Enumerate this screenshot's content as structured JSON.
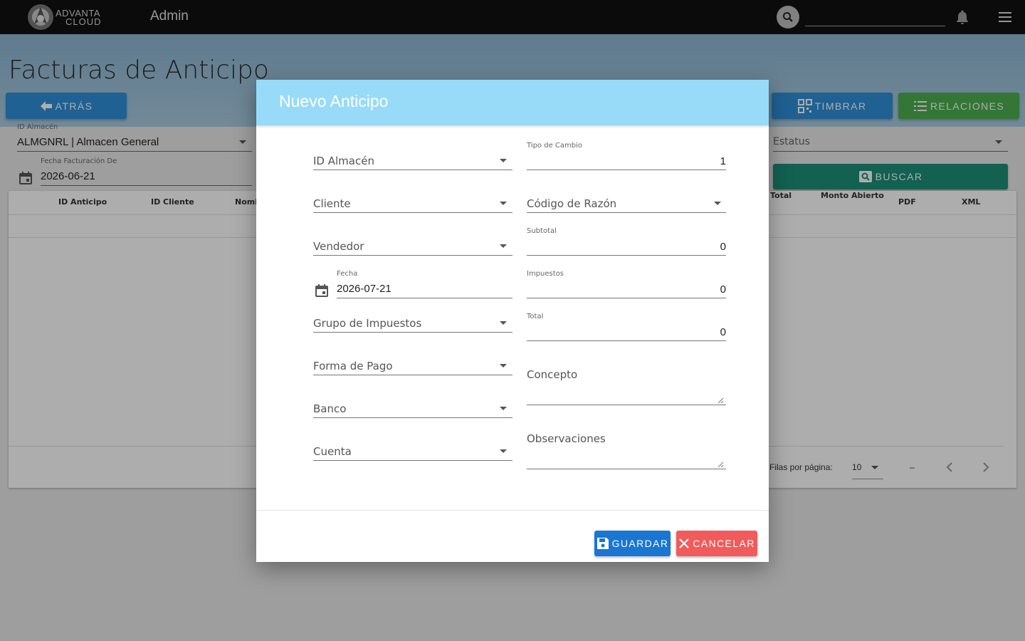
{
  "topbar": {
    "logo_line1": "ADVANTA",
    "logo_line2": "CLOUD",
    "section": "Admin",
    "search_value": ""
  },
  "page": {
    "title": "Facturas de Anticipo",
    "back_label": "ATRÁS",
    "timbrar_label": "TIMBRAR",
    "relaciones_label": "RELACIONES",
    "buscar_label": "BUSCAR"
  },
  "filters": {
    "almacen_label": "ID Almacén",
    "almacen_value": "ALMGNRL | Almacen General",
    "fecha_de_label": "Fecha Facturación De",
    "fecha_de_value": "2026-06-21",
    "estatus_placeholder": "Estatus"
  },
  "table": {
    "columns": [
      "ID Anticipo",
      "ID Cliente",
      "Nomb",
      "Total",
      "Monto Abierto",
      "PDF",
      "XML"
    ],
    "rows_per_page_label": "Filas por página:",
    "rows_per_page_value": "10",
    "range": "–"
  },
  "modal": {
    "title": "Nuevo Anticipo",
    "left_fields": {
      "almacen": "ID Almacén",
      "cliente": "Cliente",
      "vendedor": "Vendedor",
      "fecha_label": "Fecha",
      "fecha_value": "2026-07-21",
      "grupo_impuestos": "Grupo de Impuestos",
      "forma_pago": "Forma de Pago",
      "banco": "Banco",
      "cuenta": "Cuenta"
    },
    "right_fields": {
      "tipo_cambio_label": "Tipo de Cambio",
      "tipo_cambio_value": "1",
      "codigo_razon": "Código de Razón",
      "subtotal_label": "Subtotal",
      "subtotal_value": "0",
      "impuestos_label": "Impuestos",
      "impuestos_value": "0",
      "total_label": "Total",
      "total_value": "0",
      "concepto": "Concepto",
      "observaciones": "Observaciones"
    },
    "save_label": "GUARDAR",
    "cancel_label": "CANCELAR"
  },
  "colors": {
    "topbar": "#111111",
    "modal_header": "#97dbf8",
    "primary": "#1976d2",
    "success": "#4caf50",
    "danger": "#f15b5b",
    "teal": "#1b8f78"
  }
}
